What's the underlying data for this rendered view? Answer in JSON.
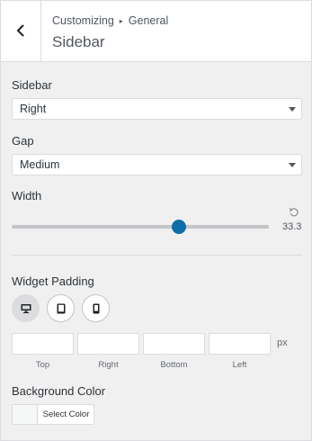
{
  "header": {
    "breadcrumb": {
      "parent": "Customizing",
      "separator": "▸",
      "section": "General"
    },
    "title": "Sidebar"
  },
  "sidebar_field": {
    "label": "Sidebar",
    "value": "Right"
  },
  "gap_field": {
    "label": "Gap",
    "value": "Medium"
  },
  "width_field": {
    "label": "Width",
    "value": "33.3",
    "slider_fraction": 0.65
  },
  "widget_padding": {
    "label": "Widget Padding",
    "devices": [
      "desktop",
      "tablet",
      "mobile"
    ],
    "active_device": "desktop",
    "inputs": [
      {
        "label": "Top",
        "value": ""
      },
      {
        "label": "Right",
        "value": ""
      },
      {
        "label": "Bottom",
        "value": ""
      },
      {
        "label": "Left",
        "value": ""
      }
    ],
    "unit": "px"
  },
  "background_color": {
    "label": "Background Color",
    "button_label": "Select Color",
    "swatch_color": "#f6f7f7"
  },
  "colors": {
    "accent": "#0f6ea8",
    "border": "#dcdcde",
    "panel": "#f0f0f1"
  }
}
